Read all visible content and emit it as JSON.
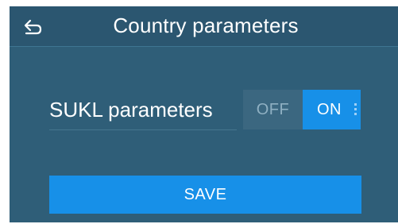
{
  "header": {
    "title": "Country parameters",
    "back_icon": "back-arrow-icon"
  },
  "setting": {
    "label": "SUKL parameters",
    "toggle": {
      "off_label": "OFF",
      "on_label": "ON",
      "selected": "ON"
    }
  },
  "actions": {
    "save_label": "SAVE"
  },
  "colors": {
    "background": "#2f5e78",
    "header_background": "#2b5670",
    "accent": "#1790e8",
    "toggle_off_background": "#3b6780",
    "text": "#ffffff"
  }
}
